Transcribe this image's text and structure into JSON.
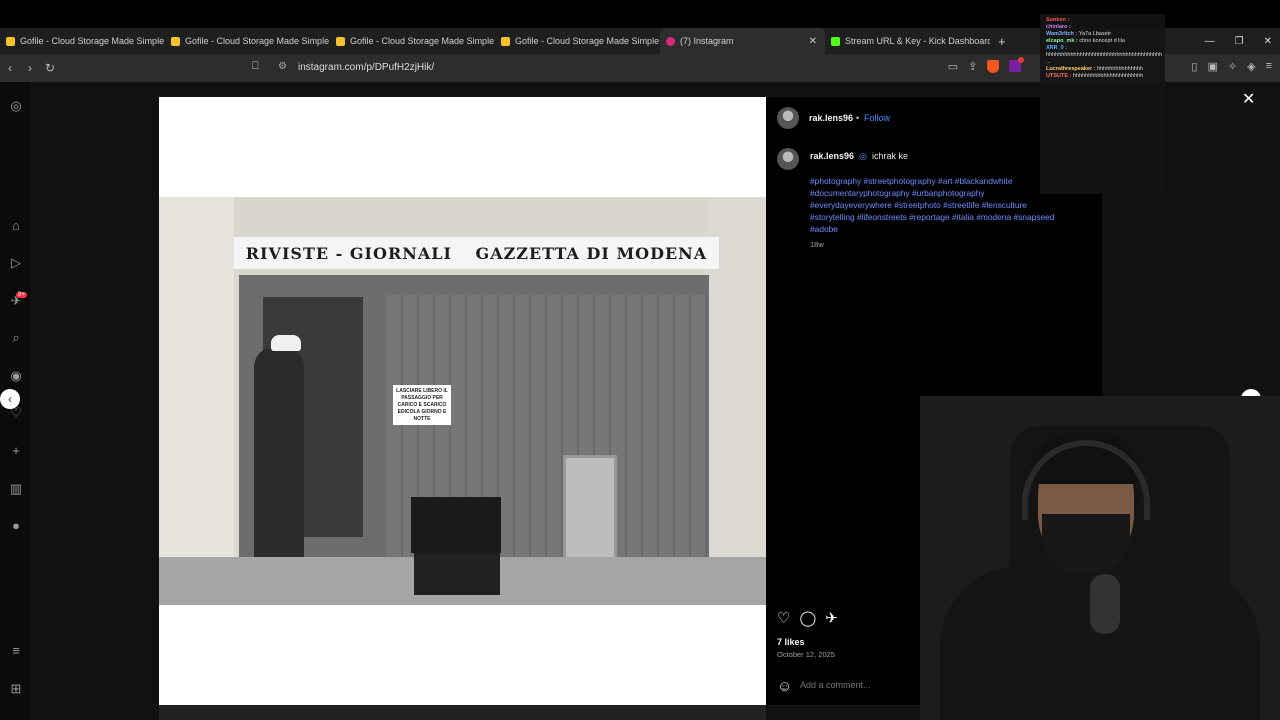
{
  "browser": {
    "tabs": [
      {
        "title": "Gofile - Cloud Storage Made Simple",
        "color": "#f2c12e"
      },
      {
        "title": "Gofile - Cloud Storage Made Simple",
        "color": "#f2c12e"
      },
      {
        "title": "Gofile - Cloud Storage Made Simple",
        "color": "#f2c12e"
      },
      {
        "title": "Gofile - Cloud Storage Made Simple",
        "color": "#f2c12e"
      },
      {
        "title": "(7) Instagram",
        "color": "#d62976"
      },
      {
        "title": "Stream URL & Key - Kick Dashboard",
        "color": "#53fc18"
      }
    ],
    "new_tab": "+",
    "url": "instagram.com/p/DPufH2zjHik/",
    "window_controls": {
      "minimize": "—",
      "maximize": "❐",
      "close": "✕"
    }
  },
  "sidebar_icons": [
    "instagram-icon",
    "home-icon",
    "reels-icon",
    "messages-icon",
    "search-icon",
    "explore-icon",
    "notifications-icon",
    "create-icon",
    "dashboard-icon",
    "profile-icon",
    "menu-icon",
    "threads-icon"
  ],
  "sidebar_badge": "9+",
  "photo": {
    "sign_left": "RIVISTE - GIORNALI",
    "sign_right": "GAZZETTA DI MODENA",
    "notice": "LASCIARE LIBERO IL PASSAGGIO PER CARICO E SCARICO EDICOLA GIORNO E NOTTE"
  },
  "post": {
    "username": "rak.lens96",
    "dot": "•",
    "follow": "Follow",
    "caption_user": "rak.lens96",
    "caption_text": "ichrak ke",
    "hashtags": "#photography #streetphotography #art #blackandwhite #documentaryphotography #urbanphotography #everydayeverywhere #streetphoto #streetlife #lensculture #storytelling #lifeonstreets #reportage #italia #modena #snapseed #adobe",
    "age": "18w",
    "likes": "7 likes",
    "date": "October 12, 2025",
    "comment_placeholder": "Add a comment..."
  },
  "chat": [
    {
      "user": "Sunken :",
      "msg": ""
    },
    {
      "user": "chinlaro :",
      "msg": ""
    },
    {
      "user": "Wam3rltch :",
      "msg": "Ya7a Lbasetr"
    },
    {
      "user": "elcapo_mk :",
      "msg": "chno koncept d lila"
    },
    {
      "user": "XRR_0 :",
      "msg": "hhhhhhhhhhhhhhhhhhhhhhhhhhhhhhhhhhhhhh ..."
    },
    {
      "user": "Lucrathrespeaker :",
      "msg": "hhhhhhhhhhhhhhh"
    },
    {
      "user": "UTSUTE :",
      "msg": "hhhhhhhhhhhhhhhhhhhhhhh"
    }
  ]
}
